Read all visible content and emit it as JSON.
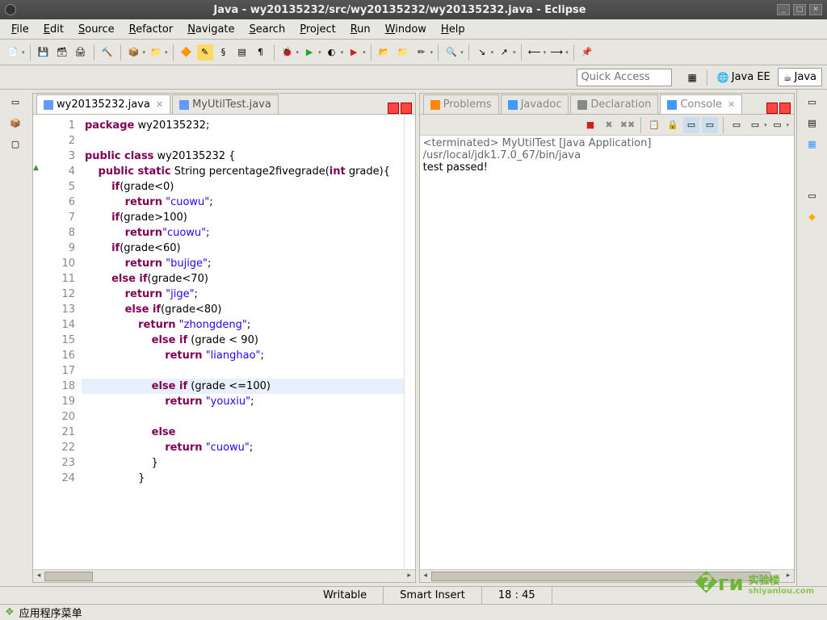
{
  "window": {
    "title": "Java - wy20135232/src/wy20135232/wy20135232.java - Eclipse"
  },
  "menu": [
    "File",
    "Edit",
    "Source",
    "Refactor",
    "Navigate",
    "Search",
    "Project",
    "Run",
    "Window",
    "Help"
  ],
  "quick_access": {
    "placeholder": "Quick Access"
  },
  "perspectives": [
    {
      "label": "",
      "icon": "open-perspective"
    },
    {
      "label": "Java EE",
      "icon": "javaee"
    },
    {
      "label": "Java",
      "icon": "java",
      "active": true
    }
  ],
  "editor_tabs": [
    {
      "label": "wy20135232.java",
      "active": true,
      "icon": "java-file"
    },
    {
      "label": "MyUtilTest.java",
      "active": false,
      "icon": "java-file"
    }
  ],
  "console_tabs": [
    {
      "label": "Problems",
      "icon": "problems"
    },
    {
      "label": "Javadoc",
      "icon": "javadoc"
    },
    {
      "label": "Declaration",
      "icon": "declaration"
    },
    {
      "label": "Console",
      "icon": "console",
      "active": true,
      "closable": true
    }
  ],
  "code_lines": [
    {
      "n": 1,
      "tokens": [
        {
          "t": "package",
          "c": "kw"
        },
        {
          "t": " wy20135232;"
        }
      ]
    },
    {
      "n": 2,
      "tokens": []
    },
    {
      "n": 3,
      "tokens": [
        {
          "t": "public class",
          "c": "kw"
        },
        {
          "t": " wy20135232 {"
        }
      ]
    },
    {
      "n": 4,
      "mark": "override",
      "tokens": [
        {
          "t": "    "
        },
        {
          "t": "public static",
          "c": "kw"
        },
        {
          "t": " String percentage2fivegrade("
        },
        {
          "t": "int",
          "c": "kw"
        },
        {
          "t": " grade){"
        }
      ]
    },
    {
      "n": 5,
      "tokens": [
        {
          "t": "        "
        },
        {
          "t": "if",
          "c": "kw"
        },
        {
          "t": "(grade<0)"
        }
      ]
    },
    {
      "n": 6,
      "tokens": [
        {
          "t": "            "
        },
        {
          "t": "return",
          "c": "kw"
        },
        {
          "t": " "
        },
        {
          "t": "\"cuowu\"",
          "c": "str"
        },
        {
          "t": ";"
        }
      ]
    },
    {
      "n": 7,
      "tokens": [
        {
          "t": "        "
        },
        {
          "t": "if",
          "c": "kw"
        },
        {
          "t": "(grade>100)"
        }
      ]
    },
    {
      "n": 8,
      "tokens": [
        {
          "t": "            "
        },
        {
          "t": "return",
          "c": "kw"
        },
        {
          "t": ""
        },
        {
          "t": "\"cuowu\"",
          "c": "str"
        },
        {
          "t": ";"
        }
      ]
    },
    {
      "n": 9,
      "tokens": [
        {
          "t": "        "
        },
        {
          "t": "if",
          "c": "kw"
        },
        {
          "t": "(grade<60)"
        }
      ]
    },
    {
      "n": 10,
      "tokens": [
        {
          "t": "            "
        },
        {
          "t": "return",
          "c": "kw"
        },
        {
          "t": " "
        },
        {
          "t": "\"bujige\"",
          "c": "str"
        },
        {
          "t": ";"
        }
      ]
    },
    {
      "n": 11,
      "tokens": [
        {
          "t": "        "
        },
        {
          "t": "else if",
          "c": "kw"
        },
        {
          "t": "(grade<70)"
        }
      ]
    },
    {
      "n": 12,
      "tokens": [
        {
          "t": "            "
        },
        {
          "t": "return",
          "c": "kw"
        },
        {
          "t": " "
        },
        {
          "t": "\"jige\"",
          "c": "str"
        },
        {
          "t": ";"
        }
      ]
    },
    {
      "n": 13,
      "tokens": [
        {
          "t": "            "
        },
        {
          "t": "else if",
          "c": "kw"
        },
        {
          "t": "(grade<80)"
        }
      ]
    },
    {
      "n": 14,
      "tokens": [
        {
          "t": "                "
        },
        {
          "t": "return",
          "c": "kw"
        },
        {
          "t": " "
        },
        {
          "t": "\"zhongdeng\"",
          "c": "str"
        },
        {
          "t": ";"
        }
      ]
    },
    {
      "n": 15,
      "tokens": [
        {
          "t": "                    "
        },
        {
          "t": "else if",
          "c": "kw"
        },
        {
          "t": " (grade < 90)"
        }
      ]
    },
    {
      "n": 16,
      "tokens": [
        {
          "t": "                        "
        },
        {
          "t": "return",
          "c": "kw"
        },
        {
          "t": " "
        },
        {
          "t": "\"lianghao\"",
          "c": "str"
        },
        {
          "t": ";"
        }
      ]
    },
    {
      "n": 17,
      "tokens": []
    },
    {
      "n": 18,
      "hl": true,
      "tokens": [
        {
          "t": "                    "
        },
        {
          "t": "else if",
          "c": "kw"
        },
        {
          "t": " (grade <=100)"
        }
      ]
    },
    {
      "n": 19,
      "tokens": [
        {
          "t": "                        "
        },
        {
          "t": "return",
          "c": "kw"
        },
        {
          "t": " "
        },
        {
          "t": "\"youxiu\"",
          "c": "str"
        },
        {
          "t": ";"
        }
      ]
    },
    {
      "n": 20,
      "tokens": []
    },
    {
      "n": 21,
      "tokens": [
        {
          "t": "                    "
        },
        {
          "t": "else",
          "c": "kw"
        }
      ]
    },
    {
      "n": 22,
      "tokens": [
        {
          "t": "                        "
        },
        {
          "t": "return",
          "c": "kw"
        },
        {
          "t": " "
        },
        {
          "t": "\"cuowu\"",
          "c": "str"
        },
        {
          "t": ";"
        }
      ]
    },
    {
      "n": 23,
      "tokens": [
        {
          "t": "                    }"
        }
      ]
    },
    {
      "n": 24,
      "tokens": [
        {
          "t": "                }"
        }
      ]
    }
  ],
  "console_output": {
    "header": "<terminated> MyUtilTest [Java Application] /usr/local/jdk1.7.0_67/bin/java",
    "body": "test passed!"
  },
  "status": {
    "writable": "Writable",
    "insert": "Smart Insert",
    "pos": "18 : 45"
  },
  "taskbar": {
    "app_menu": "应用程序菜单"
  },
  "watermark": {
    "text": "实验楼",
    "sub": "shiyanlou.com"
  }
}
